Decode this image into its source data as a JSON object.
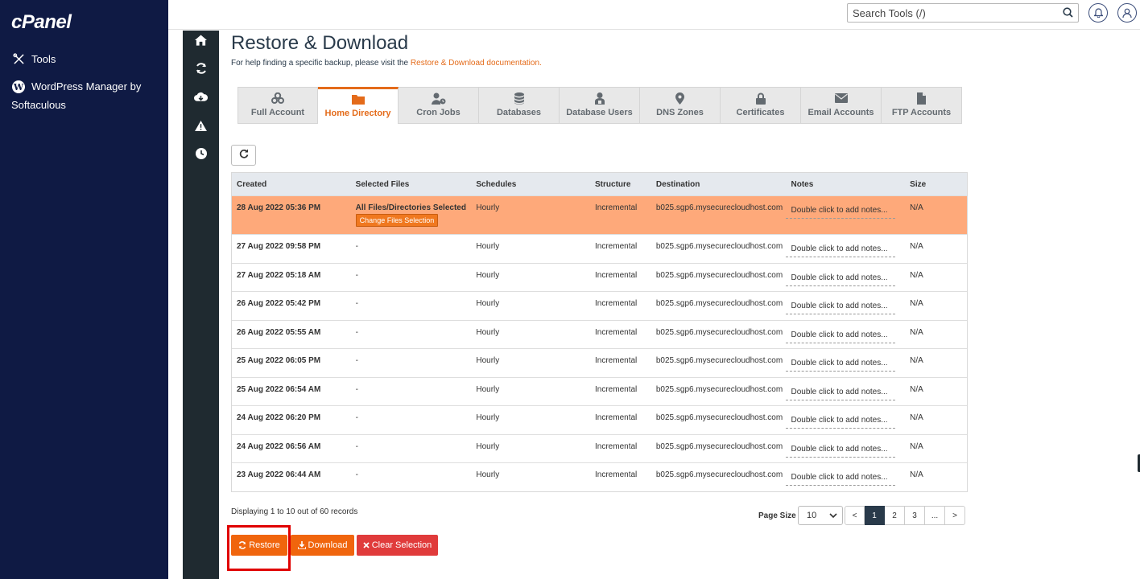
{
  "brand": {
    "logo": "cPanel"
  },
  "leftnav": {
    "items": [
      {
        "label": "Tools",
        "icon": "tools-icon"
      },
      {
        "label": "WordPress Manager by Softaculous",
        "icon": "wordpress-icon"
      }
    ]
  },
  "rail": {
    "items": [
      "home-icon",
      "sync-icon",
      "cloud-download-icon",
      "warning-icon",
      "clock-icon"
    ]
  },
  "topbar": {
    "search_placeholder": "Search Tools (/)",
    "notification_icon": "bell-icon",
    "user_icon": "user-icon"
  },
  "page": {
    "title": "Restore & Download",
    "help_prefix": "For help finding a specific backup, please visit the ",
    "help_link": "Restore & Download documentation."
  },
  "tabs": [
    {
      "label": "Full Account",
      "icon": "users-cog-icon",
      "active": false
    },
    {
      "label": "Home Directory",
      "icon": "folder-icon",
      "active": true
    },
    {
      "label": "Cron Jobs",
      "icon": "user-clock-icon",
      "active": false
    },
    {
      "label": "Databases",
      "icon": "database-icon",
      "active": false
    },
    {
      "label": "Database Users",
      "icon": "database-user-icon",
      "active": false
    },
    {
      "label": "DNS Zones",
      "icon": "map-marker-icon",
      "active": false
    },
    {
      "label": "Certificates",
      "icon": "lock-icon",
      "active": false
    },
    {
      "label": "Email Accounts",
      "icon": "envelope-icon",
      "active": false
    },
    {
      "label": "FTP Accounts",
      "icon": "file-icon",
      "active": false
    }
  ],
  "table": {
    "columns": [
      "Created",
      "Selected Files",
      "Schedules",
      "Structure",
      "Destination",
      "Notes",
      "Size"
    ],
    "rows": [
      {
        "created": "28 Aug 2022 05:36 PM",
        "files": "All Files/Directories Selected",
        "schedule": "Hourly",
        "structure": "Incremental",
        "destination": "b025.sgp6.mysecurecloudhost.com",
        "notes": "Double click to add notes...",
        "size": "N/A",
        "selected": true,
        "change_label": "Change Files Selection"
      },
      {
        "created": "27 Aug 2022 09:58 PM",
        "files": "-",
        "schedule": "Hourly",
        "structure": "Incremental",
        "destination": "b025.sgp6.mysecurecloudhost.com",
        "notes": "Double click to add notes...",
        "size": "N/A"
      },
      {
        "created": "27 Aug 2022 05:18 AM",
        "files": "-",
        "schedule": "Hourly",
        "structure": "Incremental",
        "destination": "b025.sgp6.mysecurecloudhost.com",
        "notes": "Double click to add notes...",
        "size": "N/A"
      },
      {
        "created": "26 Aug 2022 05:42 PM",
        "files": "-",
        "schedule": "Hourly",
        "structure": "Incremental",
        "destination": "b025.sgp6.mysecurecloudhost.com",
        "notes": "Double click to add notes...",
        "size": "N/A"
      },
      {
        "created": "26 Aug 2022 05:55 AM",
        "files": "-",
        "schedule": "Hourly",
        "structure": "Incremental",
        "destination": "b025.sgp6.mysecurecloudhost.com",
        "notes": "Double click to add notes...",
        "size": "N/A"
      },
      {
        "created": "25 Aug 2022 06:05 PM",
        "files": "-",
        "schedule": "Hourly",
        "structure": "Incremental",
        "destination": "b025.sgp6.mysecurecloudhost.com",
        "notes": "Double click to add notes...",
        "size": "N/A"
      },
      {
        "created": "25 Aug 2022 06:54 AM",
        "files": "-",
        "schedule": "Hourly",
        "structure": "Incremental",
        "destination": "b025.sgp6.mysecurecloudhost.com",
        "notes": "Double click to add notes...",
        "size": "N/A"
      },
      {
        "created": "24 Aug 2022 06:20 PM",
        "files": "-",
        "schedule": "Hourly",
        "structure": "Incremental",
        "destination": "b025.sgp6.mysecurecloudhost.com",
        "notes": "Double click to add notes...",
        "size": "N/A"
      },
      {
        "created": "24 Aug 2022 06:56 AM",
        "files": "-",
        "schedule": "Hourly",
        "structure": "Incremental",
        "destination": "b025.sgp6.mysecurecloudhost.com",
        "notes": "Double click to add notes...",
        "size": "N/A"
      },
      {
        "created": "23 Aug 2022 06:44 AM",
        "files": "-",
        "schedule": "Hourly",
        "structure": "Incremental",
        "destination": "b025.sgp6.mysecurecloudhost.com",
        "notes": "Double click to add notes...",
        "size": "N/A"
      }
    ]
  },
  "footer": {
    "display_text": "Displaying 1 to 10 out of 60 records",
    "page_size_label": "Page Size",
    "page_size_value": "10",
    "pages": [
      "<",
      "1",
      "2",
      "3",
      "...",
      ">"
    ],
    "current_page": "1"
  },
  "actions": {
    "restore": "Restore",
    "download": "Download",
    "clear": "Clear Selection"
  },
  "colors": {
    "accent": "#e46b1a",
    "nav_bg": "#0f1a44",
    "rail_bg": "#1f2a30",
    "selected_row": "#fea97a",
    "danger": "#e03b3b",
    "highlight": "#e00000"
  }
}
